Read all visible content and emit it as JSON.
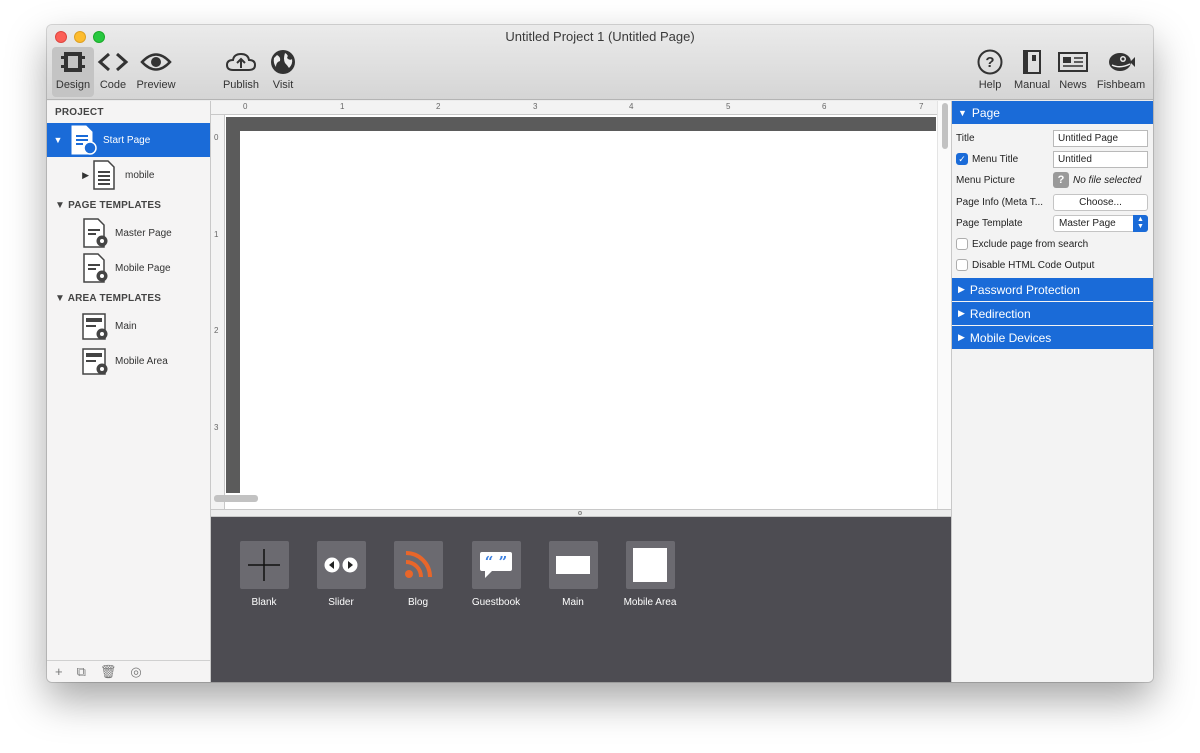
{
  "window": {
    "title": "Untitled Project 1 (Untitled Page)"
  },
  "toolbar": {
    "design": "Design",
    "code": "Code",
    "preview": "Preview",
    "publish": "Publish",
    "visit": "Visit",
    "help": "Help",
    "manual": "Manual",
    "news": "News",
    "fishbeam": "Fishbeam"
  },
  "sidebar": {
    "project_header": "PROJECT",
    "pages": [
      {
        "label": "Start Page",
        "selected": true
      },
      {
        "label": "mobile",
        "selected": false
      }
    ],
    "page_templates_header": "PAGE TEMPLATES",
    "page_templates": [
      {
        "label": "Master Page"
      },
      {
        "label": "Mobile Page"
      }
    ],
    "area_templates_header": "AREA TEMPLATES",
    "area_templates": [
      {
        "label": "Main"
      },
      {
        "label": "Mobile Area"
      }
    ]
  },
  "ruler": {
    "h": [
      "0",
      "1",
      "2",
      "3",
      "4",
      "5",
      "6",
      "7"
    ],
    "v": [
      "0",
      "1",
      "2",
      "3"
    ]
  },
  "library": {
    "items": [
      {
        "label": "Blank",
        "icon": "plus-icon"
      },
      {
        "label": "Slider",
        "icon": "slider-arrows-icon"
      },
      {
        "label": "Blog",
        "icon": "rss-icon"
      },
      {
        "label": "Guestbook",
        "icon": "speech-bubble-icon"
      },
      {
        "label": "Main",
        "icon": "area-rect-icon"
      },
      {
        "label": "Mobile Area",
        "icon": "area-square-icon"
      }
    ]
  },
  "inspector": {
    "page_section": "Page",
    "title_label": "Title",
    "title_value": "Untitled Page",
    "menu_title_label": "Menu Title",
    "menu_title_value": "Untitled",
    "menu_title_checked": true,
    "menu_picture_label": "Menu Picture",
    "menu_picture_value": "No file selected",
    "page_info_label": "Page Info (Meta T...",
    "page_info_button": "Choose...",
    "page_template_label": "Page Template",
    "page_template_value": "Master Page",
    "exclude_search_label": "Exclude page from search",
    "disable_html_label": "Disable HTML Code Output",
    "password_section": "Password Protection",
    "redirection_section": "Redirection",
    "mobile_section": "Mobile Devices"
  },
  "colors": {
    "accent": "#1a6bd8",
    "library_bg": "#4d4c52",
    "rss": "#e8662a"
  }
}
